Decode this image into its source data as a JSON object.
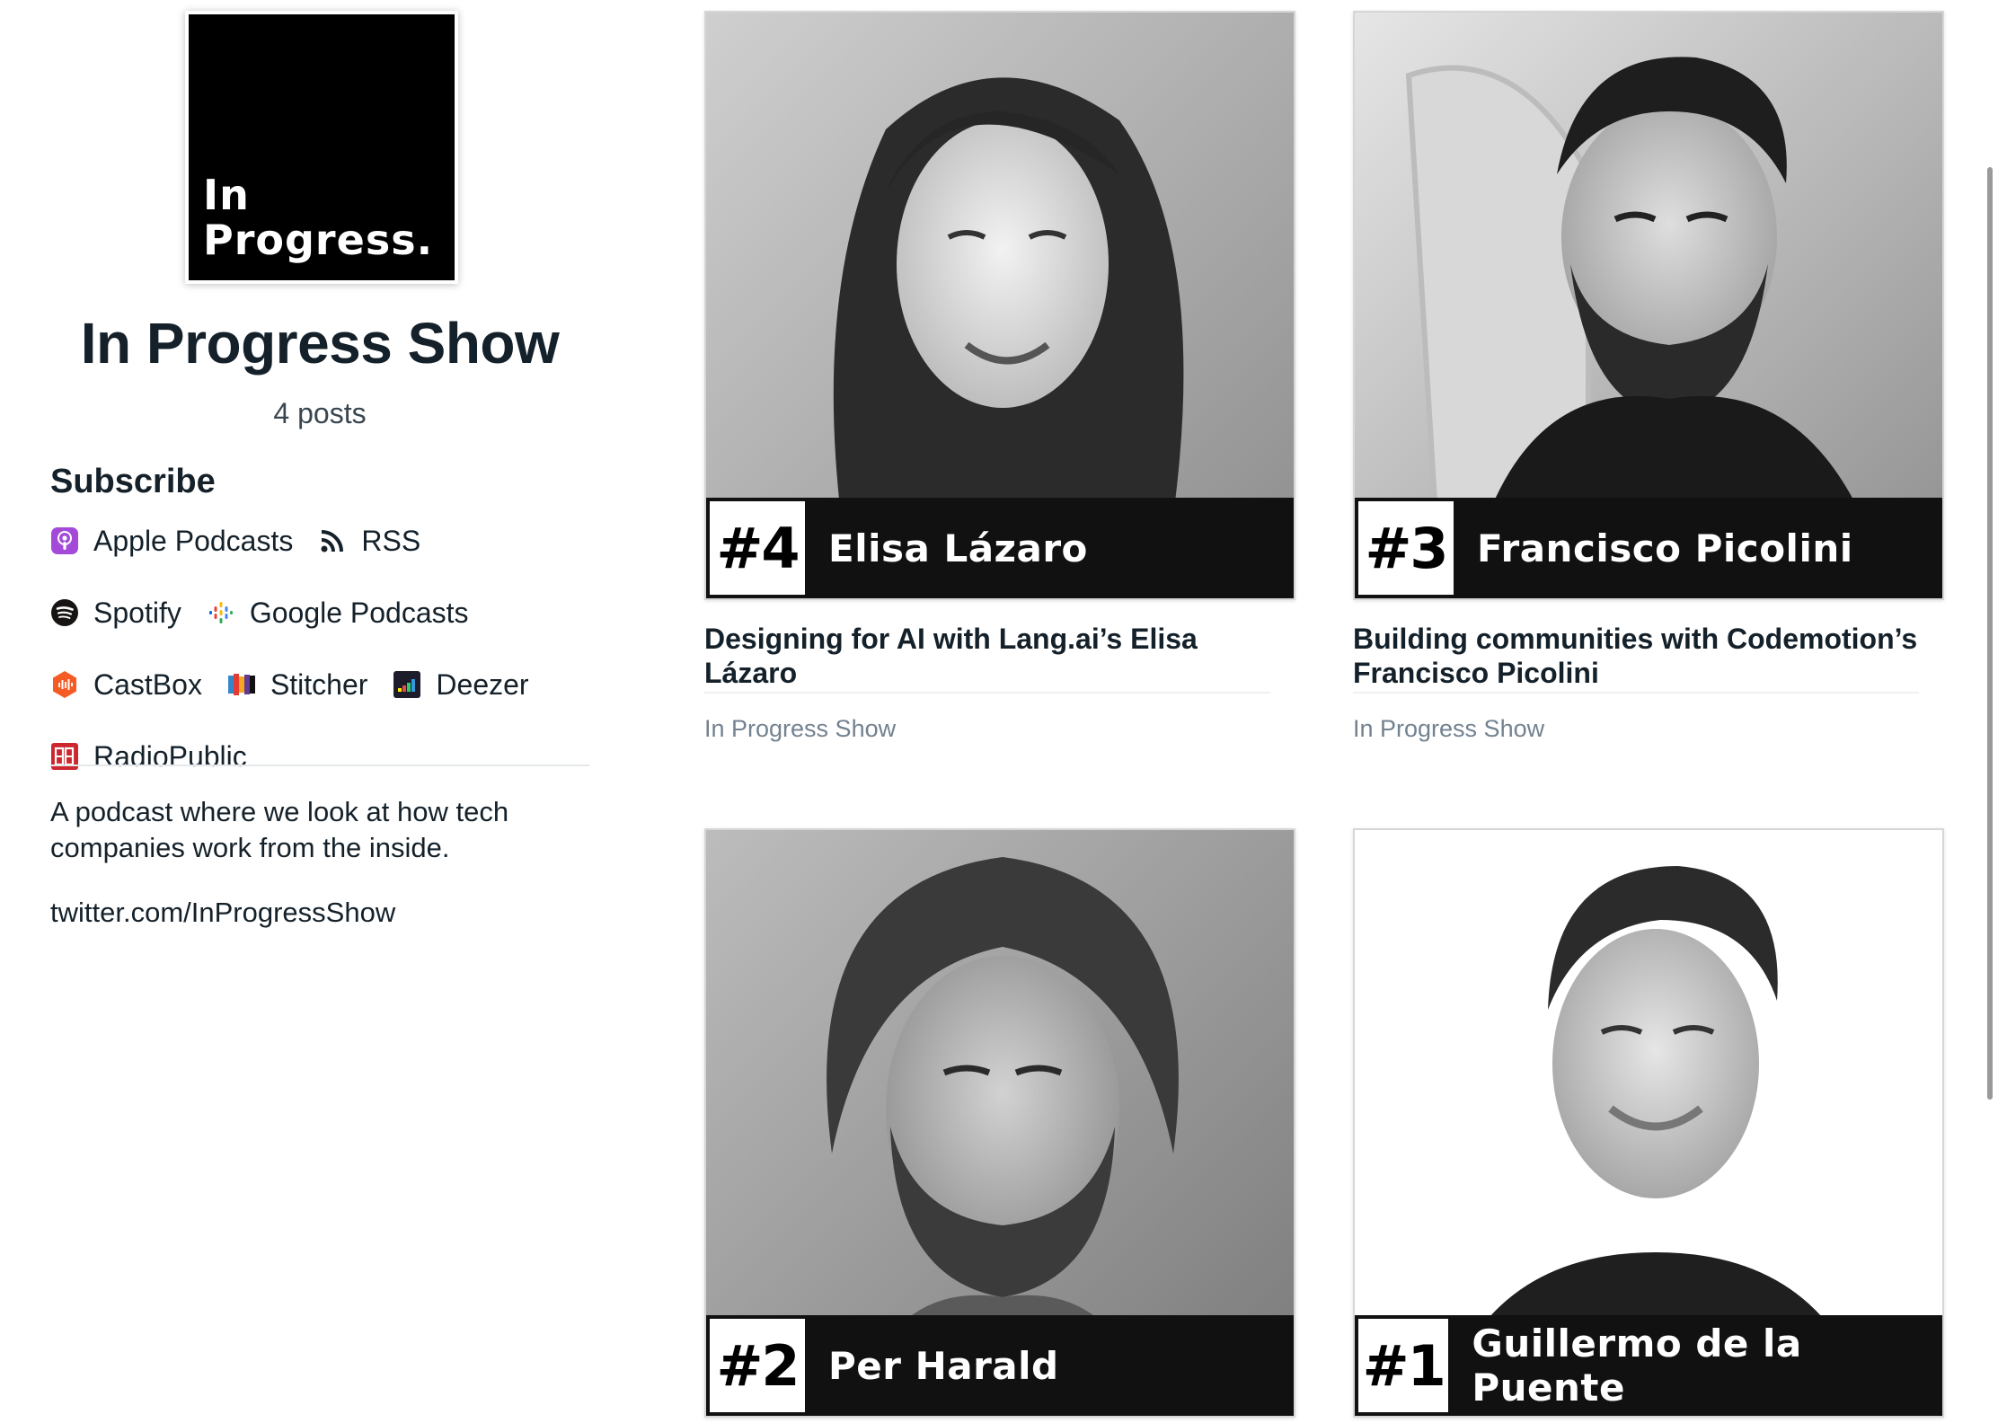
{
  "sidebar": {
    "cover": {
      "line1": "In",
      "line2": "Progress."
    },
    "show_title": "In Progress Show",
    "post_count": "4 posts",
    "subscribe_heading": "Subscribe",
    "links": [
      {
        "label": "Apple Podcasts",
        "icon": "apple-podcasts-icon"
      },
      {
        "label": "RSS",
        "icon": "rss-icon"
      },
      {
        "label": "Spotify",
        "icon": "spotify-icon"
      },
      {
        "label": "Google Podcasts",
        "icon": "google-podcasts-icon"
      },
      {
        "label": "CastBox",
        "icon": "castbox-icon"
      },
      {
        "label": "Stitcher",
        "icon": "stitcher-icon"
      },
      {
        "label": "Deezer",
        "icon": "deezer-icon"
      },
      {
        "label": "RadioPublic",
        "icon": "radiopublic-icon"
      }
    ],
    "description": "A podcast where we look at how tech companies work from the inside.",
    "twitter": "twitter.com/InProgressShow"
  },
  "episodes": [
    {
      "number": "#4",
      "guest": "Elisa Lázaro",
      "title": "Designing for AI with Lang.ai’s Elisa Lázaro",
      "tag": "In Progress Show"
    },
    {
      "number": "#3",
      "guest": "Francisco Picolini",
      "title": "Building communities with Codemotion’s Francisco Picolini",
      "tag": "In Progress Show"
    },
    {
      "number": "#2",
      "guest": "Per Harald",
      "title": "",
      "tag": ""
    },
    {
      "number": "#1",
      "guest": "Guillermo de la Puente",
      "title": "",
      "tag": ""
    }
  ],
  "colors": {
    "text": "#15212a",
    "muted": "#738290",
    "name_bar": "#111111",
    "apple_podcasts": "#a34bd8",
    "spotify": "#191414",
    "castbox": "#f55b23",
    "radiopublic": "#ce262f"
  }
}
